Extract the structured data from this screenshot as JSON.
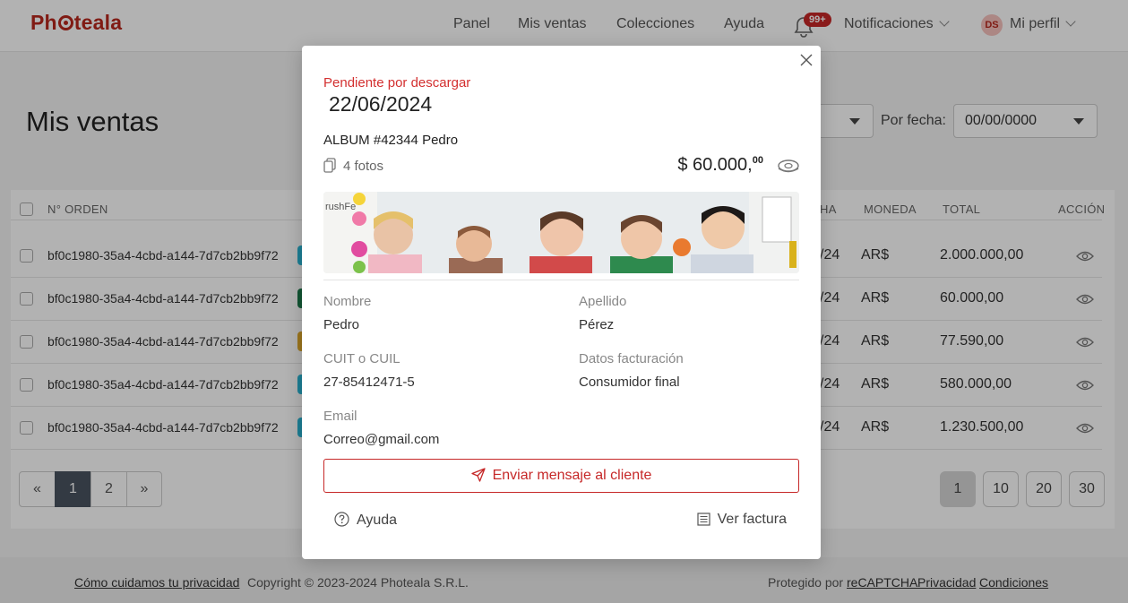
{
  "header": {
    "brand": "Photeala",
    "nav": [
      "Panel",
      "Mis ventas",
      "Colecciones",
      "Ayuda"
    ],
    "notifications_badge": "99+",
    "notifications_label": "Notificaciones",
    "avatar_initials": "DS",
    "profile_label": "Mi perfil"
  },
  "page": {
    "title": "Mis ventas",
    "filter_date_label": "Por fecha:",
    "filter_date_value": "00/00/0000"
  },
  "table": {
    "headers": {
      "order": "N° ORDEN",
      "date": "HA",
      "currency": "MONEDA",
      "total": "TOTAL",
      "action": "ACCIÓN"
    },
    "rows": [
      {
        "order": "bf0c1980-35a4-4cbd-a144-7d7cb2bb9f72",
        "date": "/24",
        "currency": "AR$",
        "total": "2.000.000,00",
        "color": "#29b6d6"
      },
      {
        "order": "bf0c1980-35a4-4cbd-a144-7d7cb2bb9f72",
        "date": "/24",
        "currency": "AR$",
        "total": "60.000,00",
        "color": "#1b7a4a"
      },
      {
        "order": "bf0c1980-35a4-4cbd-a144-7d7cb2bb9f72",
        "date": "/24",
        "currency": "AR$",
        "total": "77.590,00",
        "color": "#e0a92a"
      },
      {
        "order": "bf0c1980-35a4-4cbd-a144-7d7cb2bb9f72",
        "date": "/24",
        "currency": "AR$",
        "total": "580.000,00",
        "color": "#29b6d6"
      },
      {
        "order": "bf0c1980-35a4-4cbd-a144-7d7cb2bb9f72",
        "date": "/24",
        "currency": "AR$",
        "total": "1.230.500,00",
        "color": "#29b6d6"
      }
    ]
  },
  "pagination": {
    "pages": [
      "1",
      "2"
    ],
    "current": "1",
    "page_sizes": [
      "1",
      "10",
      "20",
      "30"
    ],
    "selected_size": "1"
  },
  "modal": {
    "status": "Pendiente por descargar",
    "date": "22/06/2024",
    "album": "ALBUM #42344 Pedro",
    "photos": "4 fotos",
    "price_main": "$ 60.000,",
    "price_cents": "00",
    "image_text": "rushFe",
    "fields": {
      "first_name_label": "Nombre",
      "first_name": "Pedro",
      "last_name_label": "Apellido",
      "last_name": "Pérez",
      "tax_id_label": "CUIT o CUIL",
      "tax_id": "27-85412471-5",
      "billing_label": "Datos facturación",
      "billing": "Consumidor final",
      "email_label": "Email",
      "email": "Correo@gmail.com"
    },
    "send_button": "Enviar mensaje al cliente",
    "help_link": "Ayuda",
    "invoice_link": "Ver factura"
  },
  "footer": {
    "privacy_link": "Cómo cuidamos tu privacidad",
    "copyright": "Copyright © 2023-2024 Photeala S.R.L.",
    "protected_by": "Protegido por",
    "recaptcha_link": "reCAPTCHA",
    "privacy2_link": "Privacidad",
    "terms_link": "Condiciones"
  },
  "colors": {
    "brand": "#b8281d",
    "alert": "#d32f2f",
    "overlay": "rgba(0,0,0,0.30)"
  }
}
